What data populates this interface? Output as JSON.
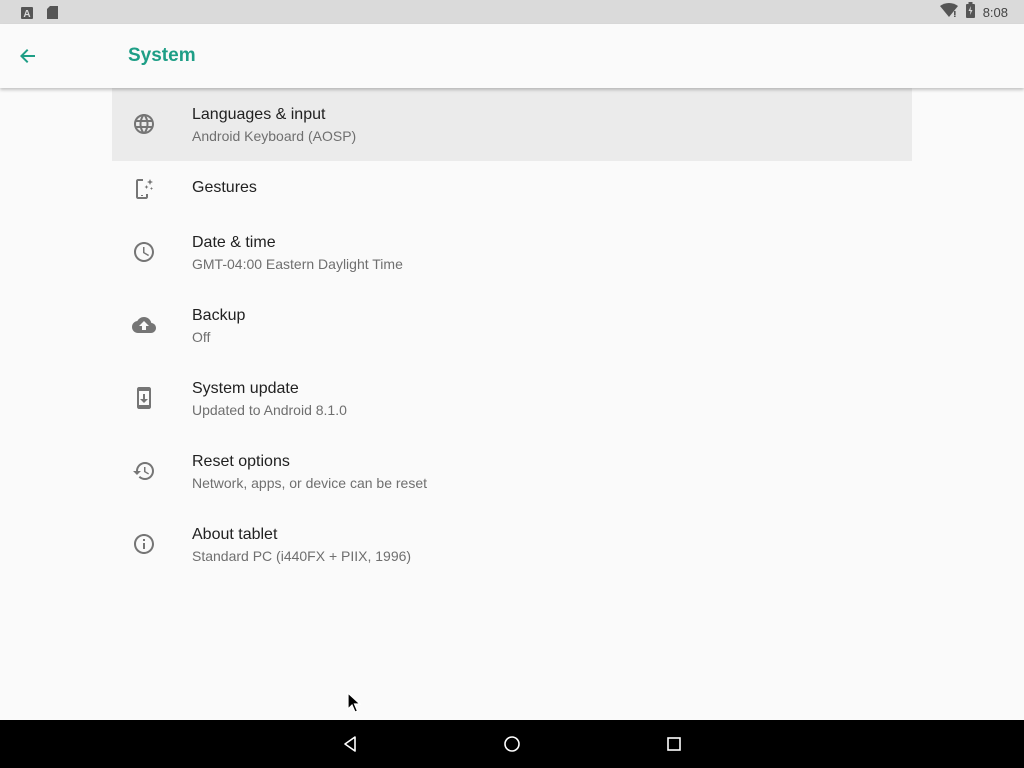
{
  "status_bar": {
    "time": "8:08",
    "left_icons": [
      "text-a-icon",
      "sd-card-icon"
    ],
    "right_icons": [
      "wifi-icon",
      "battery-icon"
    ]
  },
  "toolbar": {
    "title": "System",
    "back_icon": "arrow-back-icon"
  },
  "settings": [
    {
      "title": "Languages & input",
      "summary": "Android Keyboard (AOSP)",
      "icon": "globe-icon"
    },
    {
      "title": "Gestures",
      "summary": "",
      "icon": "gestures-phone-icon"
    },
    {
      "title": "Date & time",
      "summary": "GMT-04:00 Eastern Daylight Time",
      "icon": "clock-icon"
    },
    {
      "title": "Backup",
      "summary": "Off",
      "icon": "cloud-upload-icon"
    },
    {
      "title": "System update",
      "summary": "Updated to Android 8.1.0",
      "icon": "system-update-icon"
    },
    {
      "title": "Reset options",
      "summary": "Network, apps, or device can be reset",
      "icon": "restore-icon"
    },
    {
      "title": "About tablet",
      "summary": "Standard PC (i440FX + PIIX, 1996)",
      "icon": "info-icon"
    }
  ],
  "nav_bar": {
    "buttons": [
      "back-triangle-icon",
      "home-circle-icon",
      "recents-square-icon"
    ]
  },
  "colors": {
    "accent": "#1e9e86",
    "icon_gray": "#757575",
    "status_bar_bg": "#dadada",
    "nav_bar_bg": "#000000",
    "highlight_bg": "#ebebeb"
  }
}
